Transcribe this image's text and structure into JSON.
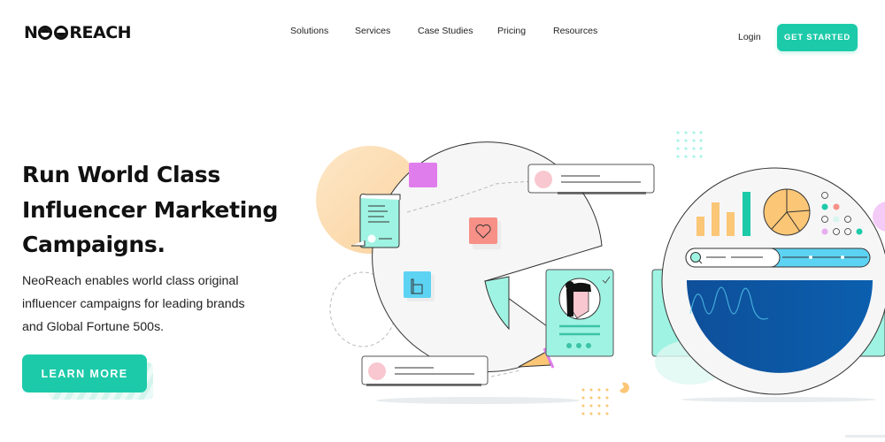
{
  "header": {
    "logo": {
      "prefix": "N",
      "suffix": "REACH",
      "full": "NEOREACH"
    },
    "nav": [
      {
        "label": "Solutions"
      },
      {
        "label": "Services"
      },
      {
        "label": "Case Studies"
      },
      {
        "label": "Pricing"
      },
      {
        "label": "Resources"
      }
    ],
    "login_label": "Login",
    "cta_label": "GET STARTED"
  },
  "hero": {
    "title_lines": [
      "Run World Class",
      "Influencer Marketing",
      "Campaigns."
    ],
    "description_lines": [
      "NeoReach enables world class original",
      "influencer campaigns for leading brands",
      "and Global Fortune 500s."
    ],
    "cta_label": "LEARN MORE"
  },
  "colors": {
    "brand_teal": "#1ccaa9",
    "mint": "#9ff3e2",
    "orange": "#fbc676",
    "pink": "#f9c7cf",
    "coral": "#f79087",
    "magenta": "#e07ded",
    "sky": "#5dd3f3",
    "navy": "#0b5aa6"
  }
}
